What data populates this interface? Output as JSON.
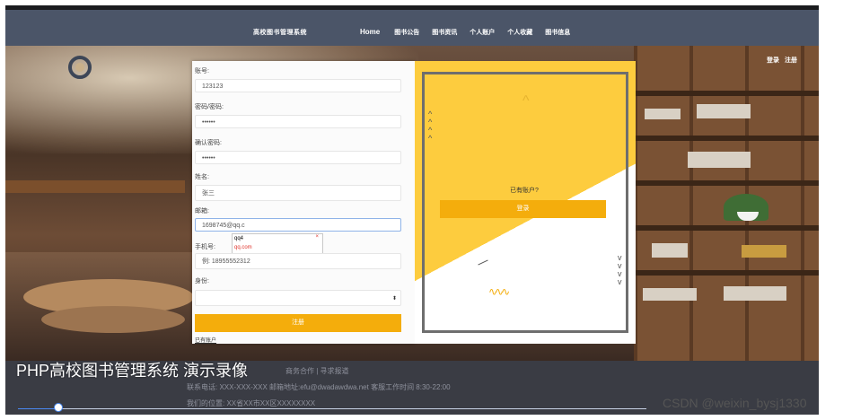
{
  "nav": {
    "site_title": "高校图书管理系统",
    "items": [
      "Home",
      "图书公告",
      "图书资讯",
      "个人账户",
      "个人收藏",
      "图书信息"
    ],
    "auth": {
      "login": "登录",
      "register": "注册"
    }
  },
  "register_form": {
    "account_label": "账号:",
    "account_value": "123123",
    "password_label": "密码/密码:",
    "password_value": "••••••",
    "confirm_label": "确认密码:",
    "confirm_value": "••••••",
    "name_label": "姓名:",
    "name_value": "张三",
    "email_label": "邮箱:",
    "email_value": "1698745@qq.c",
    "email_suggestions": [
      "qq4",
      "qq.com"
    ],
    "phone_label": "手机号:",
    "phone_placeholder": "例: 18955552312",
    "identity_label": "身份:",
    "identity_value": "",
    "register_button": "注册",
    "back_link": "已有账户"
  },
  "side_card": {
    "question": "已有账户?",
    "login_button": "登录"
  },
  "footer": {
    "links": "商务合作 | 寻求报道",
    "contact": "联系电话: XXX-XXX-XXX 邮箱地址:efu@dwadawdwa.net 客服工作时间 8:30-22:00",
    "address": "我们的位置: XX省XX市XX区XXXXXXXX"
  },
  "video": {
    "title": "PHP高校图书管理系统 演示录像",
    "progress": 0.06
  },
  "watermark": "CSDN @weixin_bysj1330"
}
